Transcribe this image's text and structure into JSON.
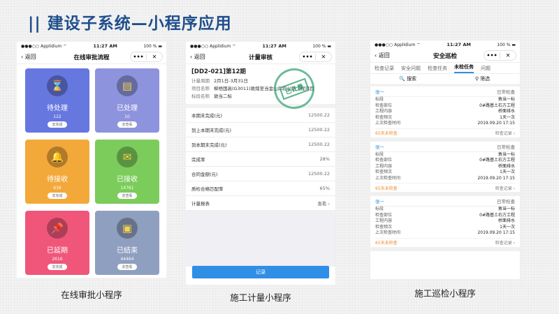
{
  "slide_title": "|| 建设子系统—小程序应用",
  "status": {
    "carrier": "●●●○○ Applidium ⌔",
    "time": "11:27 AM",
    "battery": "100 % ▬"
  },
  "phone1": {
    "back": "返回",
    "title": "在线审批流程",
    "more": "•••",
    "close": "✕",
    "cards": [
      {
        "label": "待处理",
        "count": "122",
        "btn": "去完成",
        "color": "#6677e0",
        "icon": "⌛"
      },
      {
        "label": "已处理",
        "count": "10",
        "btn": "去查看",
        "color": "#8d93dd",
        "icon": "▤"
      },
      {
        "label": "待接收",
        "count": "616",
        "btn": "去完成",
        "color": "#f3a93a",
        "icon": "🔔"
      },
      {
        "label": "已接收",
        "count": "14761",
        "btn": "去查看",
        "color": "#7ccc5c",
        "icon": "✉"
      },
      {
        "label": "已延期",
        "count": "2616",
        "btn": "去完成",
        "color": "#f0567a",
        "icon": "📌"
      },
      {
        "label": "已结束",
        "count": "44464",
        "btn": "去查看",
        "color": "#8f9fc0",
        "icon": "▣"
      }
    ],
    "caption": "在线审批小程序"
  },
  "phone2": {
    "back": "返回",
    "title": "计量审核",
    "more": "•••",
    "close": "✕",
    "code": "[DD2-021]第12期",
    "info": [
      {
        "k": "计量周期",
        "v": "2月1日-3月31日"
      },
      {
        "k": "项目名称",
        "v": "柳梧国高(G3011)敦煌至当金山口段公路工程项目"
      },
      {
        "k": "标段名称",
        "v": "敦当二标"
      }
    ],
    "stamp": "已计量",
    "rows": [
      {
        "k": "本期末完成(元)",
        "v": "12500.22"
      },
      {
        "k": "到上本期末完成(元)",
        "v": "12500.22"
      },
      {
        "k": "到本期末完成(元)",
        "v": "12500.22"
      },
      {
        "k": "完成率",
        "v": "28%"
      },
      {
        "k": "合同金额(元)",
        "v": "12500.22"
      },
      {
        "k": "质检合格匹配率",
        "v": "65%"
      },
      {
        "k": "计量报表",
        "v": "查看 ›"
      }
    ],
    "button": "记录",
    "caption": "施工计量小程序"
  },
  "phone3": {
    "back": "返回",
    "title": "安全巡检",
    "more": "•••",
    "close": "✕",
    "tabs": [
      "检查记录",
      "安全问题",
      "检查任务",
      "未检任务",
      "问题"
    ],
    "search": "🔍 搜索",
    "filter": "⚲ 筛选",
    "items": [
      {
        "who": "张一",
        "type": "日常检查",
        "fields": [
          {
            "k": "标段",
            "v": "敦当一标"
          },
          {
            "k": "检查部位",
            "v": "0#路基土石方工程"
          },
          {
            "k": "工程内容",
            "v": "桥面排水"
          },
          {
            "k": "检查频次",
            "v": "1天一次"
          },
          {
            "k": "上次检查时间",
            "v": "2019.09.20 17:15"
          }
        ],
        "overdue": "65天未检查",
        "record": "检查记录 ›"
      },
      {
        "who": "张一",
        "type": "日常检查",
        "fields": [
          {
            "k": "标段",
            "v": "敦当一标"
          },
          {
            "k": "检查部位",
            "v": "0#路基土石方工程"
          },
          {
            "k": "工程内容",
            "v": "桥面排水"
          },
          {
            "k": "检查频次",
            "v": "1天一次"
          },
          {
            "k": "上次检查时间",
            "v": "2019.09.20 17:15"
          }
        ],
        "overdue": "65天未检查",
        "record": "检查记录 ›"
      },
      {
        "who": "张一",
        "type": "日常检查",
        "fields": [
          {
            "k": "标段",
            "v": "敦当一标"
          },
          {
            "k": "检查部位",
            "v": "0#路基土石方工程"
          },
          {
            "k": "工程内容",
            "v": "桥面排水"
          },
          {
            "k": "检查频次",
            "v": "1天一次"
          },
          {
            "k": "上次检查时间",
            "v": "2019.09.20 17:15"
          }
        ],
        "overdue": "65天未检查",
        "record": "检查记录 ›"
      }
    ],
    "caption": "施工巡检小程序"
  }
}
